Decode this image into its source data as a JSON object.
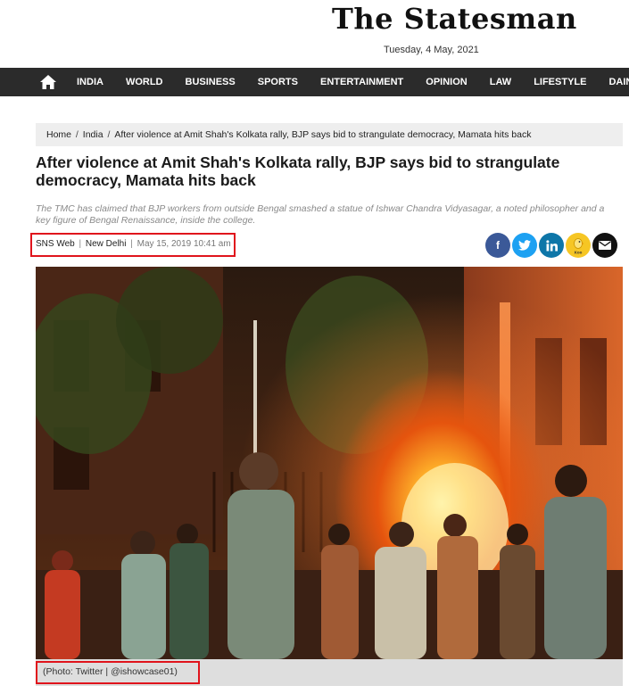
{
  "header": {
    "logo_text": "The Statesman",
    "date": "Tuesday, 4 May, 2021"
  },
  "nav": {
    "home_icon": "home-icon",
    "items": [
      "INDIA",
      "WORLD",
      "BUSINESS",
      "SPORTS",
      "ENTERTAINMENT",
      "OPINION",
      "LAW",
      "LIFESTYLE",
      "DAINIK STA"
    ]
  },
  "breadcrumb": {
    "home": "Home",
    "section": "India",
    "current": "After violence at Amit Shah's Kolkata rally, BJP says bid to strangulate democracy, Mamata hits back"
  },
  "article": {
    "headline": "After violence at Amit Shah's Kolkata rally, BJP says bid to strangulate democracy, Mamata hits back",
    "summary": "The TMC has claimed that BJP workers from outside Bengal smashed a statue of Ishwar Chandra Vidyasagar, a noted philosopher and a key figure of Bengal Renaissance, inside the college.",
    "author": "SNS Web",
    "location": "New Delhi",
    "timestamp": "May 15, 2019 10:41 am",
    "photo_caption": "(Photo: Twitter | @ishowcase01)"
  },
  "share": {
    "facebook": "f",
    "koo_label": "Koo"
  },
  "colors": {
    "nav_bg": "#2b2b2b",
    "highlight_red": "#e0141c",
    "facebook": "#3b5998",
    "twitter": "#1da1f2",
    "linkedin": "#0e76a8",
    "koo": "#f6c624"
  }
}
